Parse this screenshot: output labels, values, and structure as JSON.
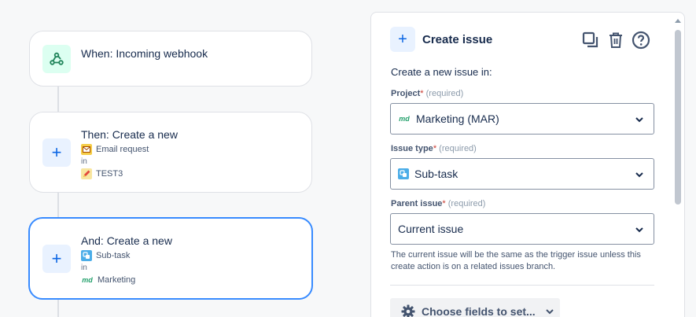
{
  "flow": {
    "trigger": {
      "title": "When: Incoming webhook",
      "icon": "webhook-icon"
    },
    "action1": {
      "title": "Then: Create a new",
      "issue_type": "Email request",
      "in_label": "in",
      "project": "TEST3"
    },
    "action2": {
      "title": "And: Create a new",
      "issue_type": "Sub-task",
      "in_label": "in",
      "project": "Marketing",
      "project_icon_text": "md"
    }
  },
  "panel": {
    "title": "Create issue",
    "description": "Create a new issue in:",
    "project": {
      "label": "Project",
      "required_mark": "*",
      "required_text": "(required)",
      "value": "Marketing (MAR)",
      "icon_text": "md"
    },
    "issue_type": {
      "label": "Issue type",
      "required_mark": "*",
      "required_text": "(required)",
      "value": "Sub-task"
    },
    "parent_issue": {
      "label": "Parent issue",
      "required_mark": "*",
      "required_text": "(required)",
      "value": "Current issue",
      "help": "The current issue will be the same as the trigger issue unless this create action is on a related issues branch."
    },
    "choose_fields_label": "Choose fields to set..."
  },
  "colors": {
    "accent": "#0c66e4",
    "selected_border": "#388bff",
    "webhook_bg": "#dcfff1",
    "required": "#c9372c"
  }
}
